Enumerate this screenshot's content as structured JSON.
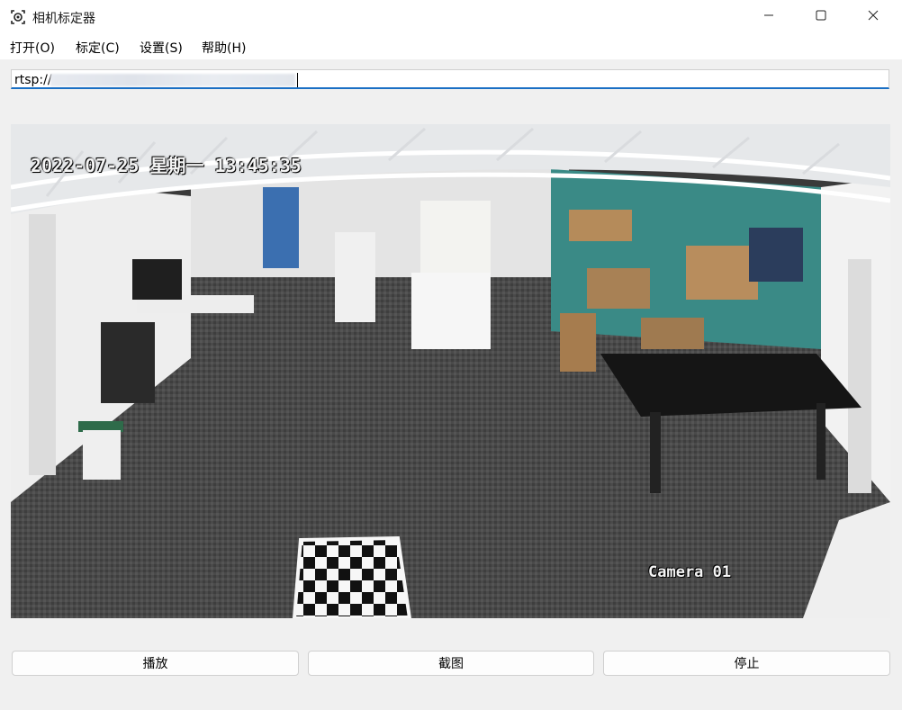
{
  "window": {
    "title": "相机标定器",
    "icons": {
      "app": "camera-icon",
      "minimize": "minimize-icon",
      "maximize": "maximize-icon",
      "close": "close-icon"
    }
  },
  "menu": {
    "items": [
      {
        "label": "打开(O)"
      },
      {
        "label": "标定(C)"
      },
      {
        "label": "设置(S)"
      },
      {
        "label": "帮助(H)"
      }
    ]
  },
  "stream": {
    "url_prefix": "rtsp://"
  },
  "video": {
    "osd_timestamp": "2022-07-25 星期一 13:45:35",
    "osd_camera": "Camera 01"
  },
  "buttons": {
    "play": "播放",
    "capture": "截图",
    "stop": "停止"
  },
  "colors": {
    "accent": "#1a6fc4",
    "titlebar": "#ffffff",
    "background": "#f0f0f0"
  }
}
